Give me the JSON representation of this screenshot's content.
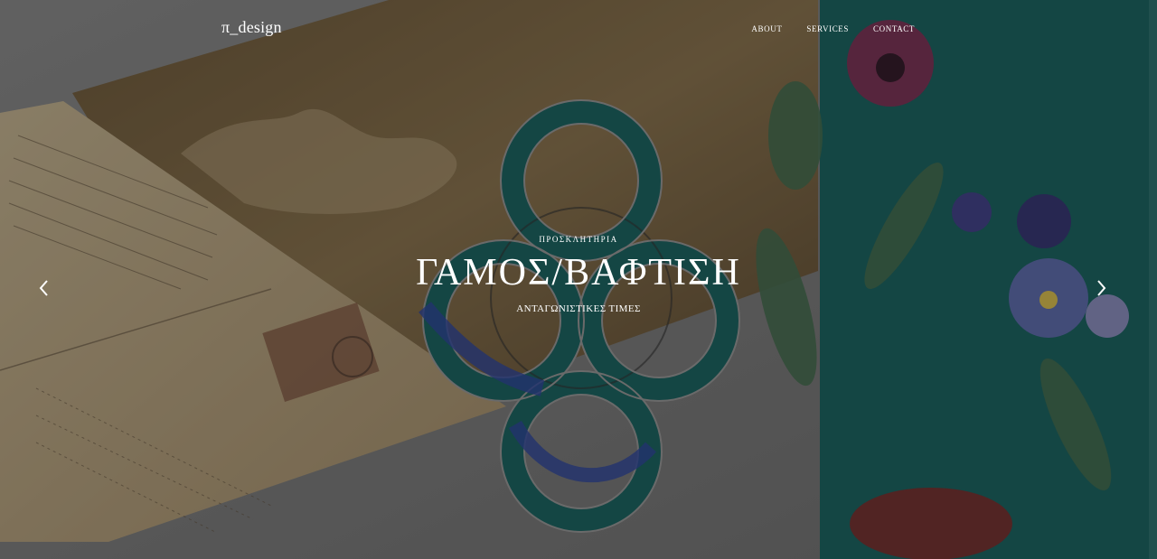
{
  "brand": {
    "name": "π_design"
  },
  "nav": {
    "items": [
      "ABOUT",
      "SERVICES",
      "CONTACT"
    ]
  },
  "slide": {
    "kicker": "ΠΡΟΣΚΛΗΤΗΡΙΑ",
    "title": "ΓΑΜΟΣ/ΒΑΦΤΙΣΗ",
    "subtitle": "ΑΝΤΑΓΩΝΙΣΤΙΚΕΣ ΤΙΜΕΣ"
  },
  "colors": {
    "teal": "#0f5f5c",
    "paper": "#c9b48d",
    "overlay": "rgba(30,30,30,0.38)",
    "text": "#ffffff"
  },
  "icons": {
    "prev": "chevron-left-icon",
    "next": "chevron-right-icon"
  }
}
